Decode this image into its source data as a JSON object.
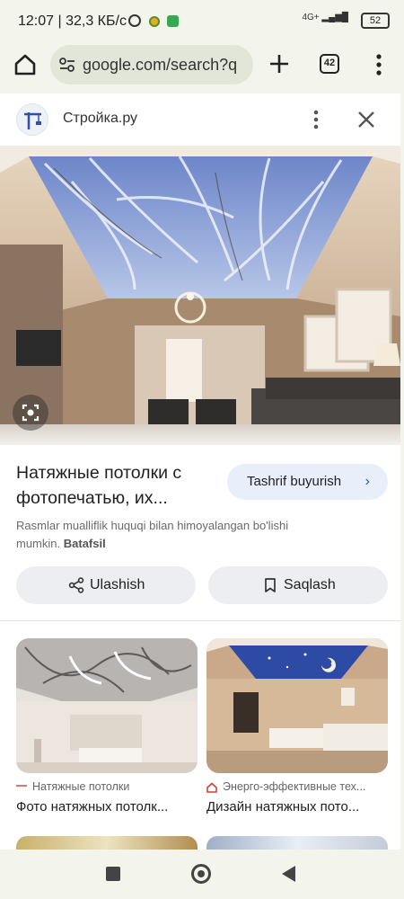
{
  "status_bar": {
    "time": "12:07",
    "speed": "32,3 КБ/с",
    "network": "4G+",
    "battery": "52"
  },
  "browser": {
    "url": "google.com/search?q",
    "tab_count": "42"
  },
  "panel": {
    "site_name": "Стройка.ру",
    "title": "Натяжные потолки с фотопечатью, их...",
    "visit_label": "Tashrif buyurish",
    "copyright_text": "Rasmlar mualliflik huquqi bilan himoyalangan bo'lishi mumkin.",
    "learn_more": "Batafsil",
    "share_label": "Ulashish",
    "save_label": "Saqlash"
  },
  "related": [
    {
      "source": "Натяжные потолки",
      "title": "Фото натяжных потолк..."
    },
    {
      "source": "Энерго-эффективные тех...",
      "title": "Дизайн натяжных пото..."
    }
  ],
  "colors": {
    "accent": "#1a56c7",
    "visit_bg": "#e8effb",
    "pill_bg": "#eceef1",
    "chrome_bg": "#f3f5ec"
  }
}
